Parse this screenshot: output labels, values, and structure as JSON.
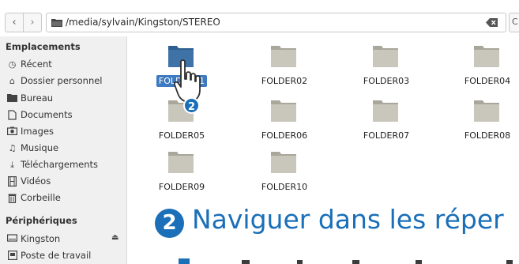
{
  "toolbar": {
    "back_icon": "chevron-left-icon",
    "forward_icon": "chevron-right-icon",
    "path": "/media/sylvain/Kingston/STEREO",
    "extra_label": "C"
  },
  "sidebar": {
    "places_heading": "Emplacements",
    "places": [
      {
        "label": "Récent",
        "icon": "clock-icon"
      },
      {
        "label": "Dossier personnel",
        "icon": "home-icon"
      },
      {
        "label": "Bureau",
        "icon": "folder-icon"
      },
      {
        "label": "Documents",
        "icon": "document-icon"
      },
      {
        "label": "Images",
        "icon": "camera-icon"
      },
      {
        "label": "Musique",
        "icon": "music-icon"
      },
      {
        "label": "Téléchargements",
        "icon": "download-icon"
      },
      {
        "label": "Vidéos",
        "icon": "film-icon"
      },
      {
        "label": "Corbeille",
        "icon": "trash-icon"
      }
    ],
    "devices_heading": "Périphériques",
    "devices": [
      {
        "label": "Kingston",
        "icon": "drive-icon"
      },
      {
        "label": "Poste de travail",
        "icon": "computer-icon"
      }
    ]
  },
  "files": [
    {
      "name": "FOLDER01",
      "selected": true
    },
    {
      "name": "FOLDER02"
    },
    {
      "name": "FOLDER03"
    },
    {
      "name": "FOLDER04"
    },
    {
      "name": "FOLDER05"
    },
    {
      "name": "FOLDER06"
    },
    {
      "name": "FOLDER07"
    },
    {
      "name": "FOLDER08"
    },
    {
      "name": "FOLDER09"
    },
    {
      "name": "FOLDER10"
    }
  ],
  "cursor_badge": "2",
  "step": {
    "number": "2",
    "title": "Naviguer dans les réper"
  },
  "colors": {
    "accent": "#1a6fb8",
    "selection": "#3d7ac2",
    "folder": "#c9c6bb"
  }
}
